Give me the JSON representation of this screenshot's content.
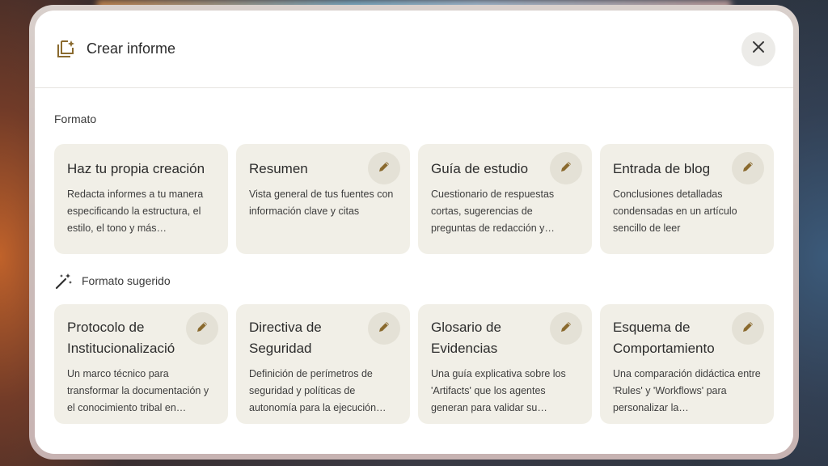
{
  "header": {
    "title": "Crear informe",
    "icon": "create-report-icon",
    "close_icon": "close-icon"
  },
  "sections": {
    "formato": {
      "label": "Formato",
      "cards": [
        {
          "title": "Haz tu propia creación",
          "description": "Redacta informes a tu manera especificando la estructura, el estilo, el tono y más…",
          "editable": false
        },
        {
          "title": "Resumen",
          "description": "Vista general de tus fuentes con información clave y citas",
          "editable": true
        },
        {
          "title": "Guía de estudio",
          "description": "Cuestionario de respuestas cortas, sugerencias de preguntas de redacción y…",
          "editable": true
        },
        {
          "title": "Entrada de blog",
          "description": "Conclusiones detalladas condensadas en un artículo sencillo de leer",
          "editable": true
        }
      ]
    },
    "sugerido": {
      "label": "Formato sugerido",
      "icon": "magic-wand-icon",
      "cards": [
        {
          "title": "Protocolo de Institucionalizació",
          "description": "Un marco técnico para transformar la documentación y el conocimiento tribal en…",
          "editable": true
        },
        {
          "title": "Directiva de Seguridad",
          "description": "Definición de perímetros de seguridad y políticas de autonomía para la ejecución…",
          "editable": true
        },
        {
          "title": "Glosario de Evidencias",
          "description": "Una guía explicativa sobre los 'Artifacts' que los agentes generan para validar su…",
          "editable": true
        },
        {
          "title": "Esquema de Comportamiento",
          "description": "Una comparación didáctica entre 'Rules' y 'Workflows' para personalizar la…",
          "editable": true
        }
      ]
    }
  },
  "colors": {
    "card_bg": "#f1efe7",
    "edit_button_bg": "#e4e1d6",
    "icon_brown": "#8a6a2e"
  }
}
